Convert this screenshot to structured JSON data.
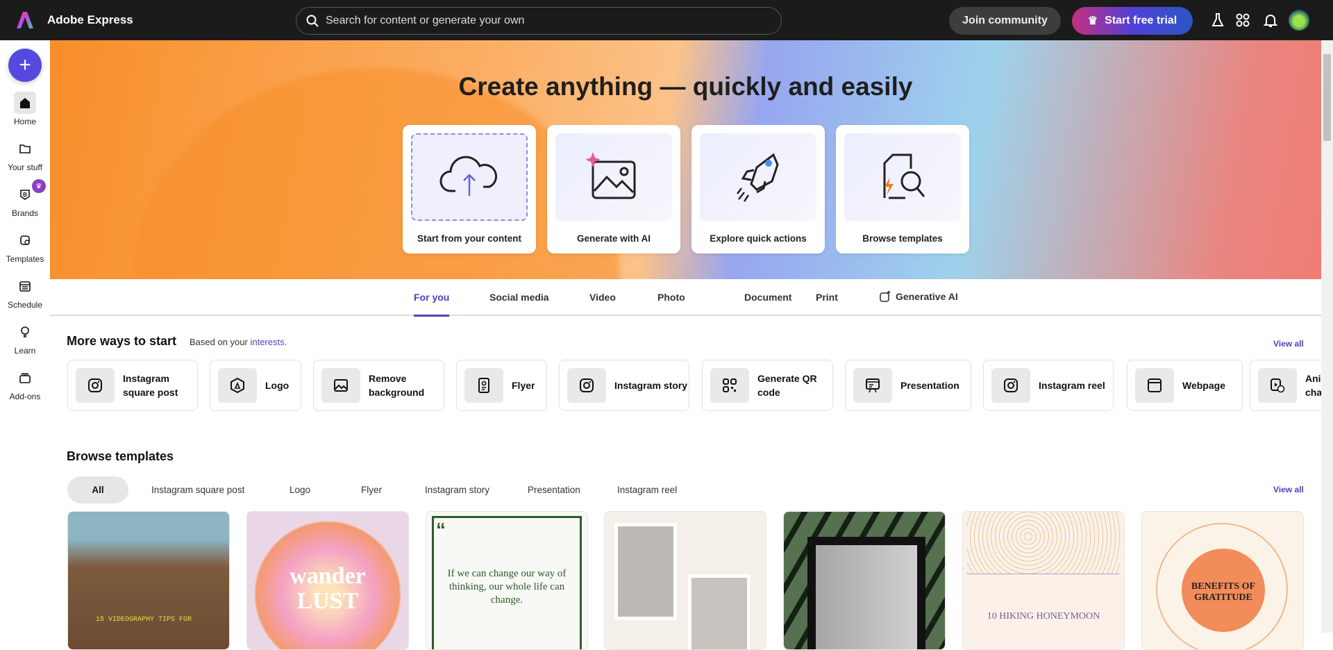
{
  "header": {
    "app_name": "Adobe Express",
    "search_placeholder": "Search for content or generate your own",
    "join_label": "Join community",
    "trial_label": "Start free trial"
  },
  "sidebar": {
    "items": [
      {
        "label": "Home"
      },
      {
        "label": "Your stuff"
      },
      {
        "label": "Brands"
      },
      {
        "label": "Templates"
      },
      {
        "label": "Schedule"
      },
      {
        "label": "Learn"
      },
      {
        "label": "Add-ons"
      }
    ]
  },
  "hero": {
    "title": "Create anything — quickly and easily",
    "cards": [
      {
        "label": "Start from your content"
      },
      {
        "label": "Generate with AI"
      },
      {
        "label": "Explore quick actions"
      },
      {
        "label": "Browse templates"
      }
    ]
  },
  "tabs": [
    {
      "label": "For you"
    },
    {
      "label": "Social media"
    },
    {
      "label": "Video"
    },
    {
      "label": "Photo"
    },
    {
      "label": "Document"
    },
    {
      "label": "Print"
    },
    {
      "label": "Generative AI"
    }
  ],
  "more_ways": {
    "title": "More ways to start",
    "subtitle": "Based on your",
    "interests_link": "interests",
    "period": ".",
    "view_all": "View all",
    "items": [
      {
        "label": "Instagram square post",
        "icon": "instagram-icon"
      },
      {
        "label": "Logo",
        "icon": "logo-icon"
      },
      {
        "label": "Remove background",
        "icon": "image-icon"
      },
      {
        "label": "Flyer",
        "icon": "flyer-icon"
      },
      {
        "label": "Instagram story",
        "icon": "instagram-icon"
      },
      {
        "label": "Generate QR code",
        "icon": "qr-code-icon"
      },
      {
        "label": "Presentation",
        "icon": "presentation-icon"
      },
      {
        "label": "Instagram reel",
        "icon": "instagram-icon"
      },
      {
        "label": "Webpage",
        "icon": "webpage-icon"
      },
      {
        "label": "Animate characters",
        "icon": "animate-icon"
      }
    ]
  },
  "browse": {
    "title": "Browse templates",
    "view_all": "View all",
    "filters": [
      {
        "label": "All"
      },
      {
        "label": "Instagram square post"
      },
      {
        "label": "Logo"
      },
      {
        "label": "Flyer"
      },
      {
        "label": "Instagram story"
      },
      {
        "label": "Presentation"
      },
      {
        "label": "Instagram reel"
      }
    ],
    "templates": [
      {
        "text": "15 VIDEOGRAPHY TIPS FOR"
      },
      {
        "text": "wander LUST"
      },
      {
        "text": "If we can change our way of thinking, our whole life can change."
      },
      {
        "text": ""
      },
      {
        "text": ""
      },
      {
        "text": "10 HIKING HONEYMOON"
      },
      {
        "text": "BENEFITS OF GRATITUDE"
      }
    ]
  },
  "colors": {
    "accent": "#4b43b8",
    "plus_button": "#5549e0",
    "header_bg": "#1b1b1b"
  }
}
